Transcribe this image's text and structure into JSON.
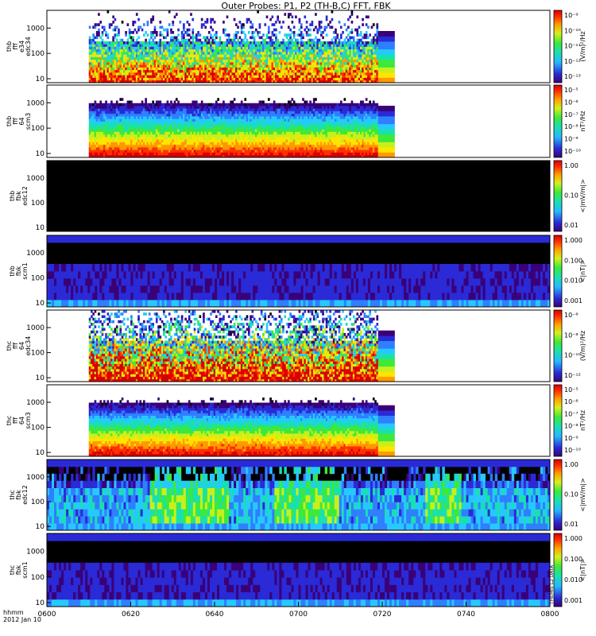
{
  "chart_data": {
    "type": "heatmap",
    "title": "Outer Probes: P1, P2 (TH-B,C) FFT, FBK",
    "xaxis": {
      "ticks": [
        "0600",
        "0620",
        "0640",
        "0700",
        "0720",
        "0740",
        "0800"
      ],
      "tick_values_min": [
        0,
        20,
        40,
        60,
        80,
        100,
        120
      ],
      "range_min": [
        0,
        120
      ],
      "label_line1": "hhmm",
      "label_line2": "2012 Jan 10"
    },
    "panels": [
      {
        "name": "thb-fff-e34",
        "ylabel": [
          "thb",
          "fff",
          "e34",
          "edc34"
        ],
        "yticks": [
          "10",
          "100",
          "1000"
        ],
        "cbar_label": "(V/m)²/Hz",
        "cbar_ticks": [
          "10⁻⁹",
          "10⁻¹⁰",
          "10⁻¹¹",
          "10⁻¹²",
          "10⁻¹³"
        ],
        "data_window_min": [
          10,
          79
        ],
        "extension_window_min": [
          79,
          83
        ],
        "style": "wave"
      },
      {
        "name": "thb-fff-scm3",
        "ylabel": [
          "thb",
          "fff",
          "64",
          "scm3"
        ],
        "yticks": [
          "10",
          "100",
          "1000"
        ],
        "cbar_label": "nT²/Hz",
        "cbar_ticks": [
          "10⁻⁵",
          "10⁻⁶",
          "10⁻⁷",
          "10⁻⁸",
          "10⁻⁹",
          "10⁻¹⁰"
        ],
        "data_window_min": [
          10,
          79
        ],
        "extension_window_min": [
          79,
          83
        ],
        "style": "band"
      },
      {
        "name": "thb-fbk-edc12",
        "ylabel": [
          "thb",
          "fbk",
          "edc12"
        ],
        "yticks": [
          "10",
          "100",
          "1000"
        ],
        "cbar_label": "<|mV/m|>",
        "cbar_ticks": [
          "1.00",
          "0.10",
          "0.01"
        ],
        "data_window_min": [
          0,
          120
        ],
        "style": "empty"
      },
      {
        "name": "thb-fbk-scm1",
        "ylabel": [
          "thb",
          "fbk",
          "scm1"
        ],
        "yticks": [
          "10",
          "100",
          "1000"
        ],
        "cbar_label": "<|nT|>",
        "cbar_ticks": [
          "1.000",
          "0.100",
          "0.010",
          "0.001"
        ],
        "data_window_min": [
          0,
          120
        ],
        "style": "fbk-quiet"
      },
      {
        "name": "thc-fff-e34",
        "ylabel": [
          "thc",
          "fff",
          "64",
          "edc34"
        ],
        "yticks": [
          "10",
          "100",
          "1000"
        ],
        "cbar_label": "(V/m)²/Hz",
        "cbar_ticks": [
          "10⁻⁶",
          "10⁻⁸",
          "10⁻¹⁰",
          "10⁻¹²"
        ],
        "data_window_min": [
          10,
          79
        ],
        "extension_window_min": [
          79,
          83
        ],
        "style": "wave-strong"
      },
      {
        "name": "thc-fff-scm3",
        "ylabel": [
          "thc",
          "fff",
          "64",
          "scm3"
        ],
        "yticks": [
          "10",
          "100",
          "1000"
        ],
        "cbar_label": "nT²/Hz",
        "cbar_ticks": [
          "10⁻⁵",
          "10⁻⁶",
          "10⁻⁷",
          "10⁻⁸",
          "10⁻⁹",
          "10⁻¹⁰"
        ],
        "data_window_min": [
          10,
          79
        ],
        "extension_window_min": [
          79,
          83
        ],
        "style": "band"
      },
      {
        "name": "thc-fbk-edc12",
        "ylabel": [
          "thc",
          "fbk",
          "edc12"
        ],
        "yticks": [
          "10",
          "100",
          "1000"
        ],
        "cbar_label": "<|mV/m|>",
        "cbar_ticks": [
          "1.00",
          "0.10",
          "0.01"
        ],
        "data_window_min": [
          0,
          120
        ],
        "style": "fbk-active"
      },
      {
        "name": "thc-fbk-scm1",
        "ylabel": [
          "thc",
          "fbk",
          "scm1"
        ],
        "yticks": [
          "10",
          "100",
          "1000"
        ],
        "cbar_label": "<|nT|>",
        "cbar_ticks": [
          "1.000",
          "0.100",
          "0.010",
          "0.001"
        ],
        "data_window_min": [
          0,
          120
        ],
        "style": "fbk-quiet2"
      }
    ],
    "colormap": [
      "#000000",
      "#3a0078",
      "#2a2ad6",
      "#2f7fff",
      "#26c9ff",
      "#19e0b0",
      "#3de93a",
      "#c6f01c",
      "#ffe400",
      "#ff9900",
      "#ff3000",
      "#d80000"
    ],
    "yscale": "log",
    "grid": false
  },
  "side_note": "THEMIS L2 DATA"
}
